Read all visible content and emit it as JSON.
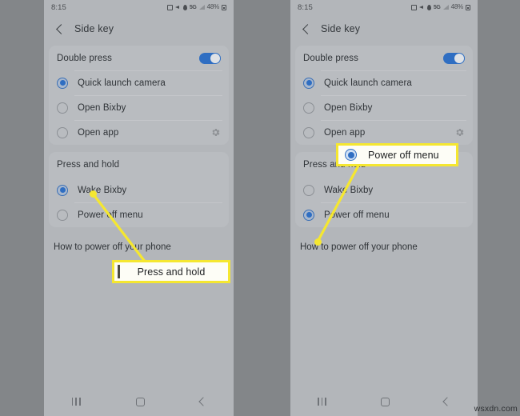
{
  "meta": {
    "watermark": "wsxdn.com",
    "accent_blue": "#2f6ec2",
    "highlight_yellow": "#f5e730",
    "page_background": "#838689",
    "phone_background": "#b3b6ba"
  },
  "status_bar": {
    "time": "8:15",
    "battery": "48%",
    "network": "5G",
    "icons": [
      "alarm-icon",
      "mute-icon",
      "location-icon",
      "network-label",
      "signal-icon",
      "battery-label",
      "battery-icon"
    ]
  },
  "app_bar": {
    "back_icon": "back-chevron-icon",
    "title": "Side key"
  },
  "sections": {
    "double_press": {
      "header": "Double press",
      "toggle_on": true,
      "options": [
        {
          "label": "Quick launch camera",
          "selected_left": true,
          "selected_right": true,
          "has_gear": false
        },
        {
          "label": "Open Bixby",
          "selected_left": false,
          "selected_right": false,
          "has_gear": false
        },
        {
          "label": "Open app",
          "selected_left": false,
          "selected_right": false,
          "has_gear": true
        }
      ]
    },
    "press_and_hold": {
      "header": "Press and hold",
      "options": [
        {
          "label": "Wake Bixby",
          "selected_left": true,
          "selected_right": false
        },
        {
          "label": "Power off menu",
          "selected_left": false,
          "selected_right": true
        }
      ]
    },
    "footer_link": "How to power off your phone"
  },
  "nav_bar": {
    "recents": "recents-icon",
    "home": "home-icon",
    "back": "back-icon"
  },
  "annotations": {
    "left": {
      "callout_text": "Press and hold",
      "points_to": "Press and hold section header"
    },
    "right": {
      "callout_text": "Power off menu",
      "points_to": "Power off menu radio option"
    }
  }
}
